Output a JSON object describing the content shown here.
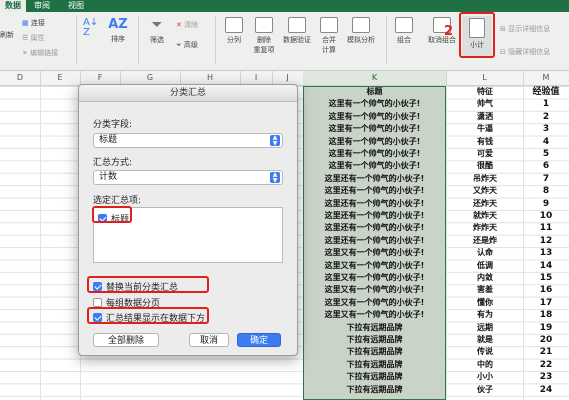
{
  "ribbon": {
    "tabs": [
      {
        "label": "数据",
        "active": true
      },
      {
        "label": "审阅",
        "active": false
      },
      {
        "label": "视图",
        "active": false
      }
    ],
    "buttons": {
      "refresh": "刷新",
      "connections": "连接",
      "properties": "属性",
      "edit_links": "编辑链接",
      "sort": "排序",
      "filter": "筛选",
      "clear": "清除",
      "advanced": "高级",
      "split": "分列",
      "remove_duplicates_1": "删除",
      "remove_duplicates_2": "重复项",
      "data_validation": "数据验证",
      "consolidate_1": "合并",
      "consolidate_2": "计算",
      "what_if": "模拟分析",
      "group": "组合",
      "ungroup": "取消组合",
      "subtotal": "小计",
      "show_detail": "显示详细信息",
      "hide_detail": "隐藏详细信息"
    },
    "step_number": "2"
  },
  "sheet": {
    "columns": [
      "D",
      "E",
      "F",
      "G",
      "H",
      "I",
      "J",
      "K",
      "L",
      "M"
    ],
    "headers": {
      "k": "标题",
      "l": "特征",
      "m": "经验值"
    },
    "rows": [
      {
        "k": "这里有一个帅气的小伙子!",
        "l": "帅气",
        "m": "1"
      },
      {
        "k": "这里有一个帅气的小伙子!",
        "l": "潇洒",
        "m": "2"
      },
      {
        "k": "这里有一个帅气的小伙子!",
        "l": "牛逼",
        "m": "3"
      },
      {
        "k": "这里有一个帅气的小伙子!",
        "l": "有钱",
        "m": "4"
      },
      {
        "k": "这里有一个帅气的小伙子!",
        "l": "可爱",
        "m": "5"
      },
      {
        "k": "这里有一个帅气的小伙子!",
        "l": "很酷",
        "m": "6"
      },
      {
        "k": "这里还有一个帅气的小伙子!",
        "l": "吊炸天",
        "m": "7"
      },
      {
        "k": "这里还有一个帅气的小伙子!",
        "l": "又炸天",
        "m": "8"
      },
      {
        "k": "这里还有一个帅气的小伙子!",
        "l": "还炸天",
        "m": "9"
      },
      {
        "k": "这里还有一个帅气的小伙子!",
        "l": "就炸天",
        "m": "10"
      },
      {
        "k": "这里还有一个帅气的小伙子!",
        "l": "炸炸天",
        "m": "11"
      },
      {
        "k": "这里还有一个帅气的小伙子!",
        "l": "还是炸",
        "m": "12"
      },
      {
        "k": "这里又有一个帅气的小伙子!",
        "l": "认命",
        "m": "13"
      },
      {
        "k": "这里又有一个帅气的小伙子!",
        "l": "低调",
        "m": "14"
      },
      {
        "k": "这里又有一个帅气的小伙子!",
        "l": "内敛",
        "m": "15"
      },
      {
        "k": "这里又有一个帅气的小伙子!",
        "l": "害羞",
        "m": "16"
      },
      {
        "k": "这里又有一个帅气的小伙子!",
        "l": "懂你",
        "m": "17"
      },
      {
        "k": "这里又有一个帅气的小伙子!",
        "l": "有为",
        "m": "18"
      },
      {
        "k": "下拉有远期品牌",
        "l": "远期",
        "m": "19"
      },
      {
        "k": "下拉有远期品牌",
        "l": "就是",
        "m": "20"
      },
      {
        "k": "下拉有远期品牌",
        "l": "传说",
        "m": "21"
      },
      {
        "k": "下拉有远期品牌",
        "l": "中的",
        "m": "22"
      },
      {
        "k": "下拉有远期品牌",
        "l": "小小",
        "m": "23"
      },
      {
        "k": "下拉有远期品牌",
        "l": "伙子",
        "m": "24"
      }
    ]
  },
  "dialog": {
    "title": "分类汇总",
    "field_label": "分类字段:",
    "field_value": "标题",
    "function_label": "汇总方式:",
    "function_value": "计数",
    "items_label": "选定汇总项:",
    "items": [
      {
        "label": "标题",
        "checked": true
      }
    ],
    "replace_label": "替换当前分类汇总",
    "replace_checked": true,
    "pagebreak_label": "每组数据分页",
    "pagebreak_checked": false,
    "summary_below_label": "汇总结果显示在数据下方",
    "summary_below_checked": true,
    "remove_all": "全部删除",
    "cancel": "取消",
    "ok": "确定"
  },
  "colors": {
    "excel_green": "#1f7145",
    "accent_blue": "#3d7cf0",
    "highlight_red": "#e0201b"
  }
}
